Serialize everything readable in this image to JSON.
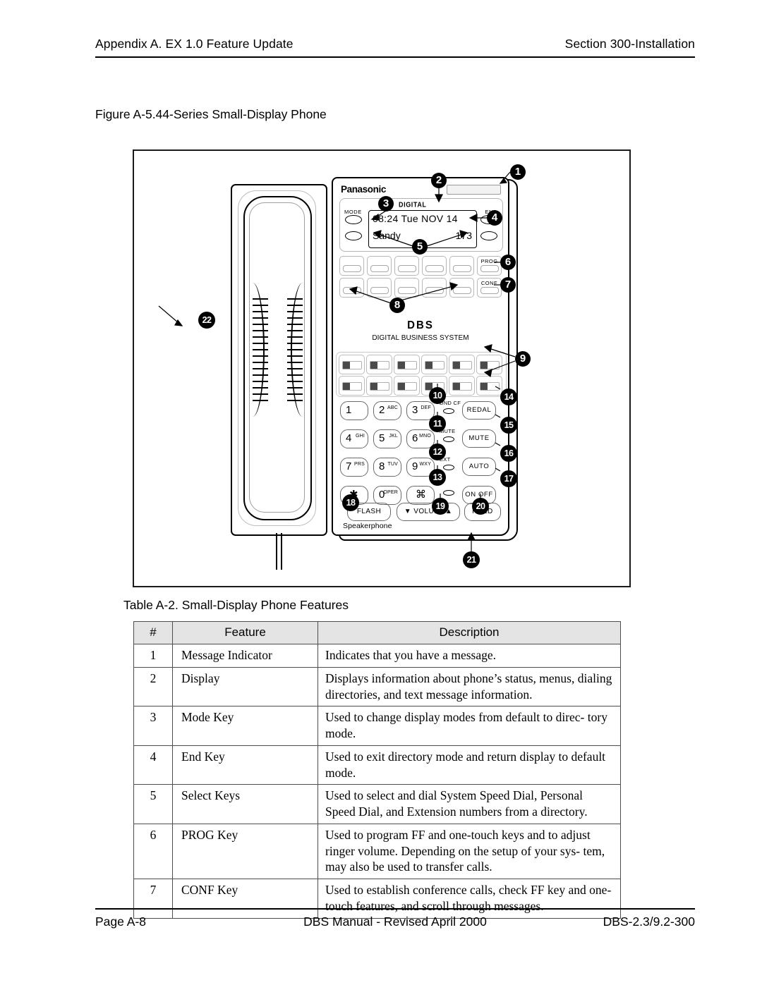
{
  "header": {
    "left": "Appendix A. EX 1.0 Feature Update",
    "right": "Section 300-Installation"
  },
  "figure": {
    "caption": "Figure A-5.44-Series Small-Display Phone",
    "phone": {
      "brand": "Panasonic",
      "digital_label": "DIGITAL",
      "mode_label": "MODE",
      "end_label": "END",
      "lcd": {
        "line1": "08:24  Tue NOV 14",
        "line2_left": "Sandy",
        "line2_right": "173"
      },
      "prog_label": "PROG",
      "conf_label": "CONF",
      "logo": "DBS",
      "logo_subtitle": "DIGITAL BUSINESS SYSTEM",
      "speakerphone_label": "Speakerphone",
      "dial_keys": [
        {
          "digit": "1",
          "letters": ""
        },
        {
          "digit": "2",
          "letters": "ABC"
        },
        {
          "digit": "3",
          "letters": "DEF"
        },
        {
          "digit": "4",
          "letters": "GHI"
        },
        {
          "digit": "5",
          "letters": "JKL"
        },
        {
          "digit": "6",
          "letters": "MNO"
        },
        {
          "digit": "7",
          "letters": "PRS"
        },
        {
          "digit": "8",
          "letters": "TUV"
        },
        {
          "digit": "9",
          "letters": "WXY"
        },
        {
          "digit": "✱",
          "letters": ""
        },
        {
          "digit": "0",
          "letters": "OPER"
        },
        {
          "digit": "⌘",
          "letters": ""
        }
      ],
      "indicators": [
        {
          "label": "DND CF"
        },
        {
          "label": "MUTE"
        },
        {
          "label": "EXT"
        },
        {
          "label": ""
        }
      ],
      "function_keys": [
        "REDAL",
        "MUTE",
        "AUTO",
        "ON OFF"
      ],
      "bottom_keys": [
        "FLASH",
        "▼ VOLUME▲",
        "HOLD"
      ]
    },
    "callouts": [
      {
        "n": "1"
      },
      {
        "n": "2"
      },
      {
        "n": "3"
      },
      {
        "n": "4"
      },
      {
        "n": "5"
      },
      {
        "n": "6"
      },
      {
        "n": "7"
      },
      {
        "n": "8"
      },
      {
        "n": "9"
      },
      {
        "n": "10"
      },
      {
        "n": "11"
      },
      {
        "n": "12"
      },
      {
        "n": "13"
      },
      {
        "n": "14"
      },
      {
        "n": "15"
      },
      {
        "n": "16"
      },
      {
        "n": "17"
      },
      {
        "n": "18"
      },
      {
        "n": "19"
      },
      {
        "n": "20"
      },
      {
        "n": "21"
      },
      {
        "n": "22"
      }
    ]
  },
  "table": {
    "caption": "Table A-2. Small-Display Phone Features",
    "columns": [
      "#",
      "Feature",
      "Description"
    ],
    "rows": [
      {
        "num": "1",
        "feature": "Message Indicator",
        "description": "Indicates that you have a message."
      },
      {
        "num": "2",
        "feature": "Display",
        "description": "Displays information about phone’s status, menus, dialing directories, and text message information."
      },
      {
        "num": "3",
        "feature": "Mode Key",
        "description": "Used to change display modes from default to direc- tory mode."
      },
      {
        "num": "4",
        "feature": "End Key",
        "description": "Used to exit directory mode and return display to default mode."
      },
      {
        "num": "5",
        "feature": "Select Keys",
        "description": "Used to select and dial System Speed Dial, Personal Speed Dial, and Extension numbers from a directory."
      },
      {
        "num": "6",
        "feature": "PROG Key",
        "description": "Used to program FF and one-touch keys and to adjust ringer volume. Depending on the setup of your sys- tem, may also be used to transfer calls."
      },
      {
        "num": "7",
        "feature": "CONF Key",
        "description": "Used to establish conference calls, check FF key and one-touch features, and scroll through messages."
      }
    ]
  },
  "footer": {
    "left": "Page A-8",
    "center": "DBS Manual - Revised April 2000",
    "right": "DBS-2.3/9.2-300"
  }
}
